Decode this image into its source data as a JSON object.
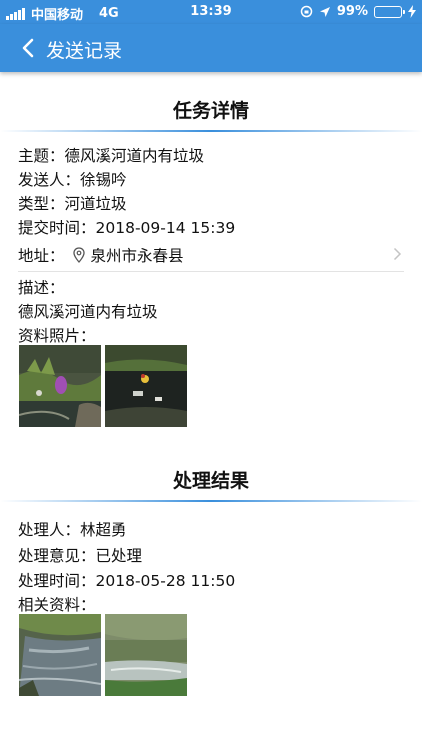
{
  "status_bar": {
    "carrier": "中国移动",
    "network": "4G",
    "time": "13:39",
    "battery_percent": "99%",
    "battery_level": 0.99
  },
  "nav": {
    "title": "发送记录",
    "back_icon": "back-chevron-icon"
  },
  "task": {
    "section_title": "任务详情",
    "subject_label": "主题：",
    "subject": "德风溪河道内有垃圾",
    "sender_label": "发送人：",
    "sender": "徐锡吟",
    "type_label": "类型：",
    "type": "河道垃圾",
    "submit_time_label": "提交时间：",
    "submit_time": "2018-09-14 15:39",
    "address_label": "地址：",
    "address": "泉州市永春县",
    "description_label": "描述：",
    "description": "德风溪河道内有垃圾",
    "photos_label": "资料照片："
  },
  "result": {
    "section_title": "处理结果",
    "handler_label": "处理人：",
    "handler": "林超勇",
    "opinion_label": "处理意见：",
    "opinion": "已处理",
    "process_time_label": "处理时间：",
    "process_time": "2018-05-28 11:50",
    "materials_label": "相关资料："
  },
  "colors": {
    "primary": "#3a8fdc",
    "divider": "#e3e3e3"
  }
}
